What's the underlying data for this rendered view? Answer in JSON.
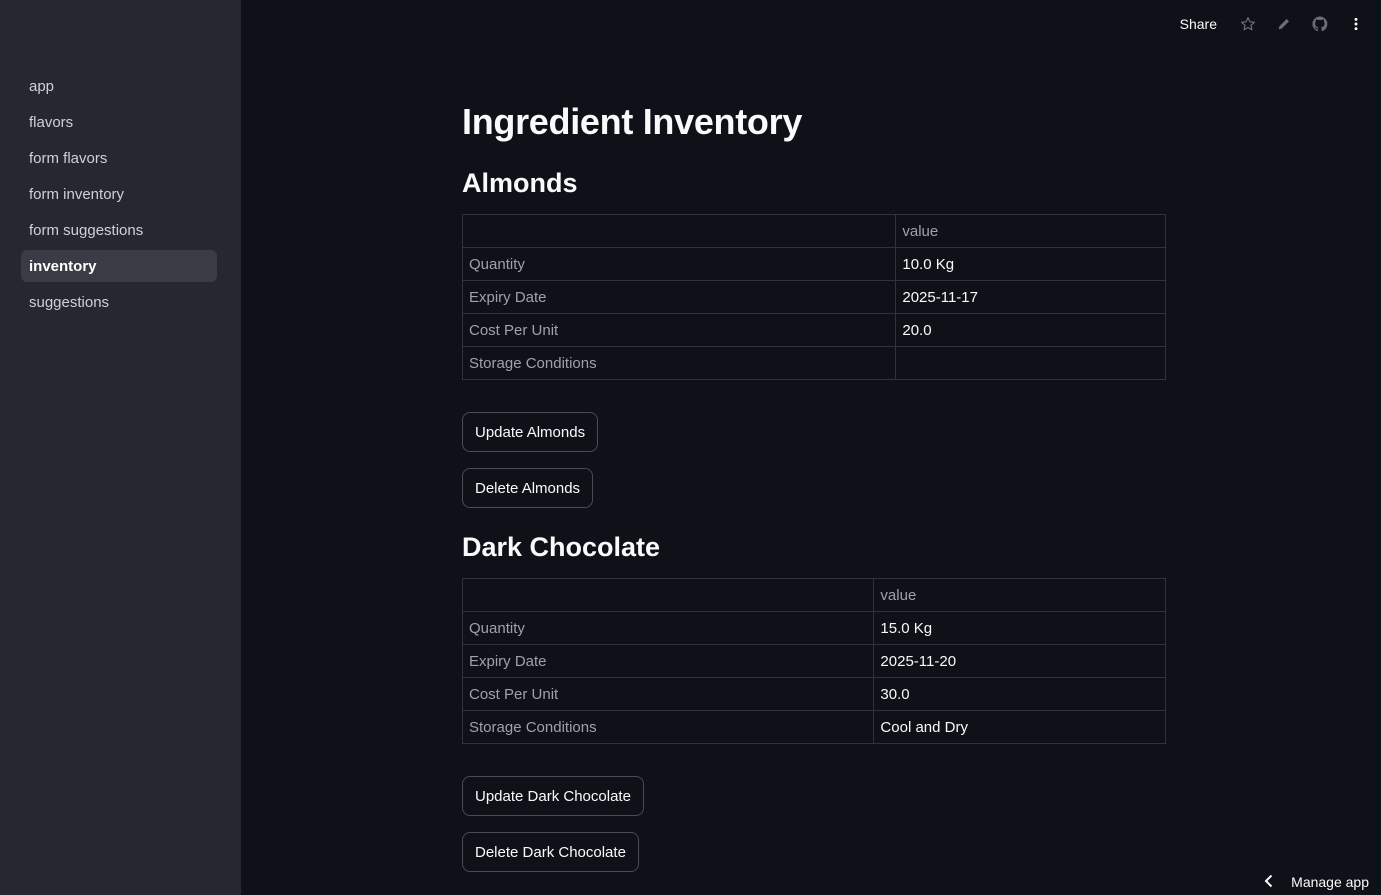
{
  "sidebar": {
    "items": [
      {
        "label": "app"
      },
      {
        "label": "flavors"
      },
      {
        "label": "form flavors"
      },
      {
        "label": "form inventory"
      },
      {
        "label": "form suggestions"
      },
      {
        "label": "inventory",
        "active": true
      },
      {
        "label": "suggestions"
      }
    ]
  },
  "header": {
    "share_label": "Share",
    "icons": [
      "star-icon",
      "edit-pencil-icon",
      "github-icon",
      "more-vertical-icon"
    ]
  },
  "page": {
    "title": "Ingredient Inventory",
    "sections": [
      {
        "heading": "Almonds",
        "table": {
          "column_header": "value",
          "rows": [
            {
              "label": "Quantity",
              "value": "10.0 Kg"
            },
            {
              "label": "Expiry Date",
              "value": "2025-11-17"
            },
            {
              "label": "Cost Per Unit",
              "value": "20.0"
            },
            {
              "label": "Storage Conditions",
              "value": ""
            }
          ]
        },
        "update_label": "Update Almonds",
        "delete_label": "Delete Almonds"
      },
      {
        "heading": "Dark Chocolate",
        "table": {
          "column_header": "value",
          "rows": [
            {
              "label": "Quantity",
              "value": "15.0 Kg"
            },
            {
              "label": "Expiry Date",
              "value": "2025-11-20"
            },
            {
              "label": "Cost Per Unit",
              "value": "30.0"
            },
            {
              "label": "Storage Conditions",
              "value": "Cool and Dry"
            }
          ]
        },
        "update_label": "Update Dark Chocolate",
        "delete_label": "Delete Dark Chocolate"
      }
    ]
  },
  "footer": {
    "manage_label": "Manage app"
  },
  "colors": {
    "background": "#0e1117",
    "sidebar": "#262730",
    "active_item": "#3a3b45",
    "table_border": "#2f3340",
    "muted_text": "#9fa2ab"
  }
}
